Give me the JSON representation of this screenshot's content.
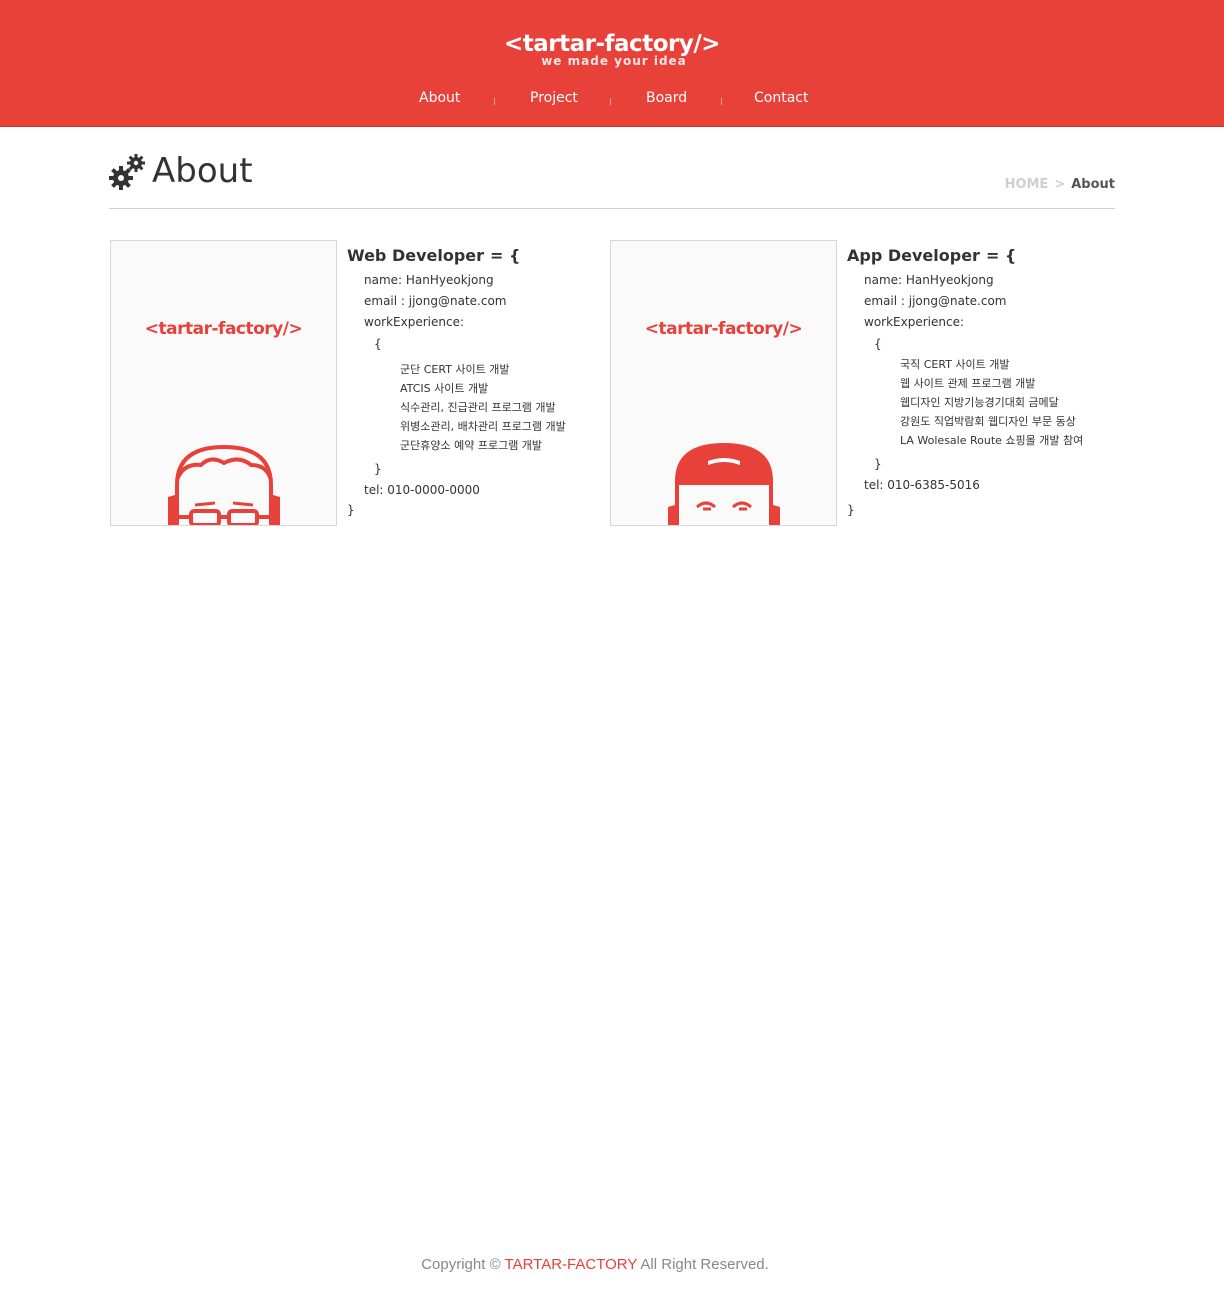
{
  "colors": {
    "accent": "#e8413a",
    "text": "#333333",
    "muted": "#cfcfcf"
  },
  "header": {
    "logo_title": "<tartar-factory/>",
    "logo_tagline": "we made your idea",
    "nav": [
      "About",
      "Project",
      "Board",
      "Contact"
    ]
  },
  "page": {
    "title": "About",
    "title_icon": "gears-icon",
    "breadcrumb": {
      "home": "HOME",
      "separator": ">",
      "current": "About"
    }
  },
  "profiles": [
    {
      "card_logo": "<tartar-factory/>",
      "avatar_icon": "glasses-face-icon",
      "role": "Web Developer",
      "assign": "= {",
      "name_line": "name: HanHyeokjong",
      "email_line": "email : jjong@nate.com",
      "work_label": "workExperience:",
      "open_brace": "{",
      "items": [
        "군단 CERT 사이트 개발",
        "ATCIS 사이트 개발",
        "식수관리, 진급관리 프로그램 개발",
        "위병소관리, 배차관리 프로그램 개발",
        "군단휴양소 예약 프로그램 개발"
      ],
      "close_inner": "}",
      "tel_line": "tel: 010-0000-0000",
      "close_outer": "}"
    },
    {
      "card_logo": "<tartar-factory/>",
      "avatar_icon": "cap-face-icon",
      "role": "App Developer",
      "assign": "= {",
      "name_line": "name: HanHyeokjong",
      "email_line": "email : jjong@nate.com",
      "work_label": "workExperience:",
      "open_brace": "{",
      "items": [
        "국직 CERT 사이트 개발",
        "웹 사이트 관제 프로그램 개발",
        "웹디자인 지방기능경기대회 금메달",
        "강원도 직업박람회 웹디자인 부문 동상",
        "LA Wolesale Route 쇼핑몰 개발 참여"
      ],
      "close_inner": "}",
      "tel_line": "tel: 010-6385-5016",
      "close_outer": "}"
    }
  ],
  "footer": {
    "prefix": "Copyright ©",
    "brand": "TARTAR-FACTORY",
    "suffix": "All Right Reserved."
  }
}
